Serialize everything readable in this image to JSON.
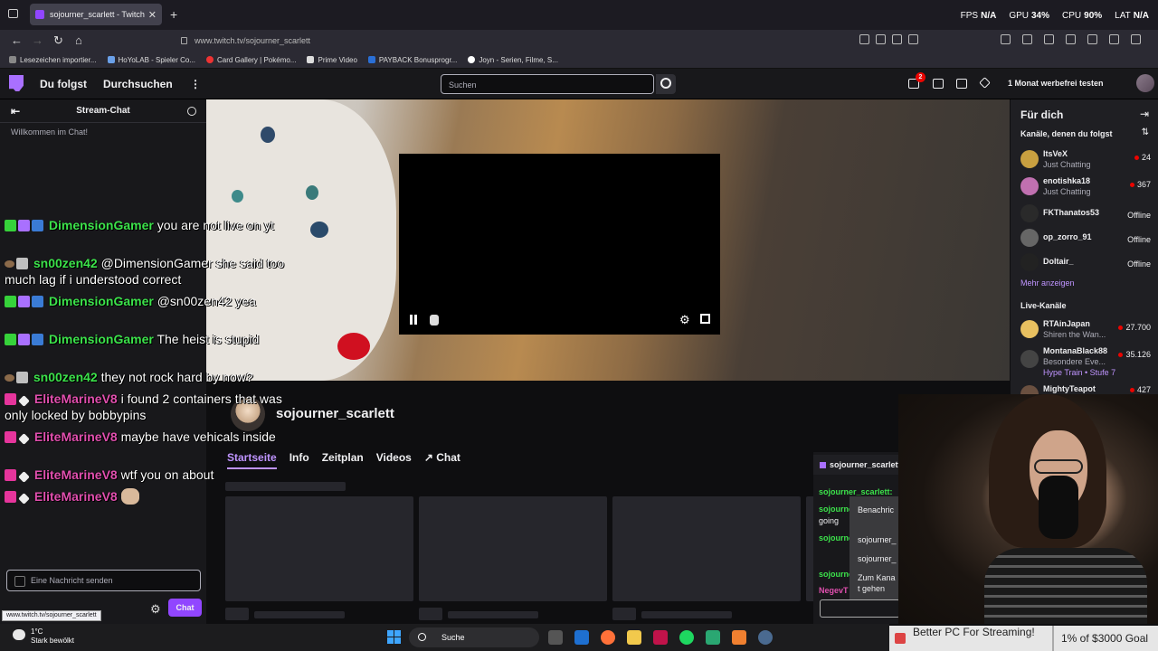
{
  "browser": {
    "tab_title": "sojourner_scarlett - Twitch",
    "url": "www.twitch.tv/sojourner_scarlett",
    "bookmarks": [
      "Lesezeichen importier...",
      "HoYoLAB - Spieler Co...",
      "Card Gallery | Pokémo...",
      "Prime Video",
      "PAYBACK Bonusprogr...",
      "Joyn - Serien, Filme, S..."
    ],
    "stats": {
      "fps_label": "FPS",
      "fps_value": "N/A",
      "gpu_label": "GPU",
      "gpu_value": "34%",
      "cpu_label": "CPU",
      "cpu_value": "90%",
      "lat_label": "LAT",
      "lat_value": "N/A"
    }
  },
  "twitch_nav": {
    "following": "Du folgst",
    "browse": "Durchsuchen",
    "more": "⋮",
    "search_placeholder": "Suchen",
    "notification_count": "2",
    "turbo_label": "1 Monat werbefrei testen"
  },
  "chat": {
    "title": "Stream-Chat",
    "welcome": "Willkommen im Chat!",
    "input_placeholder": "Eine Nachricht senden",
    "chat_button": "Chat"
  },
  "overlay_chat": [
    {
      "user": "DimensionGamer",
      "message": "you are not live on yt"
    },
    {
      "user": "sn00zen42",
      "message": "@DimensionGamer she said too much lag if i understood correct"
    },
    {
      "user": "DimensionGamer",
      "message": "@sn00zen42 yea"
    },
    {
      "user": "DimensionGamer",
      "message": "The heist is stupid"
    },
    {
      "user": "sn00zen42",
      "message": "they not rock hard by now?"
    },
    {
      "user": "EliteMarineV8",
      "message": "i found 2 containers that was only locked by bobbypins"
    },
    {
      "user": "EliteMarineV8",
      "message": "maybe have vehicals inside"
    },
    {
      "user": "EliteMarineV8",
      "message": "wtf you on about"
    },
    {
      "user": "EliteMarineV8",
      "message": ""
    }
  ],
  "channel": {
    "name": "sojourner_scarlett",
    "tabs": [
      "Startseite",
      "Info",
      "Zeitplan",
      "Videos",
      "Chat"
    ],
    "chat_tab_icon": "↗"
  },
  "right_sidebar": {
    "title": "Für dich",
    "followed_section": "Kanäle, denen du folgst",
    "followed": [
      {
        "name": "ItsVeX",
        "game": "Just Chatting",
        "viewers": "24"
      },
      {
        "name": "enotishka18",
        "game": "Just Chatting",
        "viewers": "367"
      },
      {
        "name": "FKThanatos53",
        "status": "Offline"
      },
      {
        "name": "op_zorro_91",
        "status": "Offline"
      },
      {
        "name": "Doltair_",
        "status": "Offline"
      }
    ],
    "show_more": "Mehr anzeigen",
    "live_section": "Live-Kanäle",
    "live": [
      {
        "name": "RTAinJapan",
        "game": "Shiren the Wan...",
        "viewers": "27.700"
      },
      {
        "name": "MontanaBlack88",
        "game": "Besondere Eve...",
        "extra": "Hype Train • Stufe 7",
        "viewers": "35.126"
      },
      {
        "name": "MightyTeapot",
        "game": "",
        "viewers": "427"
      }
    ]
  },
  "popout_chat": {
    "header": "sojourner_scarlett",
    "lines": [
      "sojourner_scarlett:",
      "sojourner",
      "going",
      "sojourner",
      "sojourner",
      "NegevT"
    ],
    "menu": [
      "Benachric",
      "sojourner_",
      "sojourner_",
      "Zum Kana",
      "t gehen"
    ]
  },
  "donation": {
    "left": "Better PC For Streaming!",
    "right": "1% of $3000 Goal"
  },
  "status_link": "www.twitch.tv/sojourner_scarlett",
  "taskbar": {
    "temperature": "1°C",
    "weather": "Stark bewölkt",
    "search": "Suche"
  }
}
